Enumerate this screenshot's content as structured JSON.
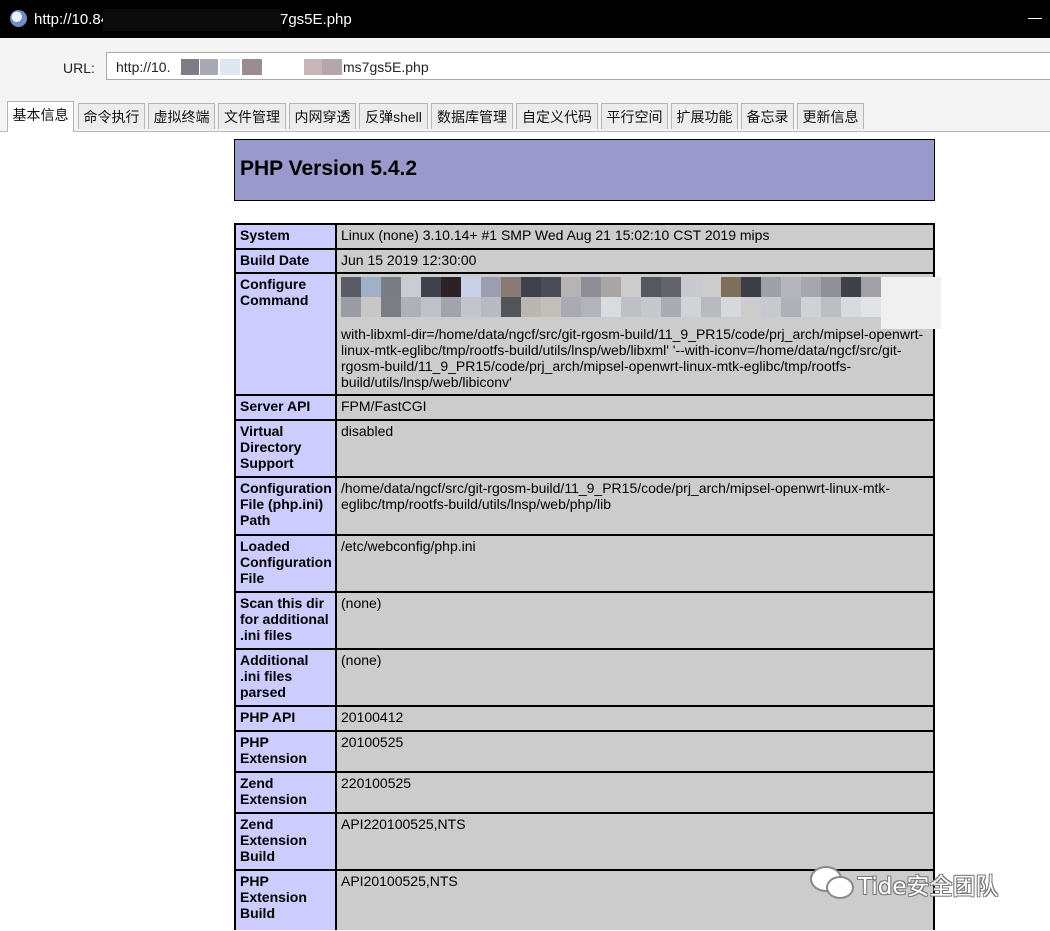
{
  "window": {
    "title_left": "http://10.84",
    "title_right": "7gs5E.php"
  },
  "address": {
    "label": "URL:",
    "value_left": "http://10.",
    "value_right": "ms7gs5E.php"
  },
  "tabs": [
    {
      "label": "基本信息",
      "active": true
    },
    {
      "label": "命令执行"
    },
    {
      "label": "虚拟终端"
    },
    {
      "label": "文件管理"
    },
    {
      "label": "内网穿透"
    },
    {
      "label": "反弹shell"
    },
    {
      "label": "数据库管理"
    },
    {
      "label": "自定义代码"
    },
    {
      "label": "平行空间"
    },
    {
      "label": "扩展功能"
    },
    {
      "label": "备忘录"
    },
    {
      "label": "更新信息"
    }
  ],
  "phpinfo": {
    "heading": "PHP Version 5.4.2",
    "rows": [
      {
        "key": "System",
        "value": "Linux (none) 3.10.14+ #1 SMP Wed Aug 21 15:02:10 CST 2019 mips"
      },
      {
        "key": "Build Date",
        "value": "Jun 15 2019 12:30:00"
      },
      {
        "key": "Configure Command",
        "value": "with-libxml-dir=/home/data/ngcf/src/git-rgosm-build/11_9_PR15/code/prj_arch/mipsel-openwrt-linux-mtk-eglibc/tmp/rootfs-build/utils/lnsp/web/libxml' '--with-iconv=/home/data/ngcf/src/git-rgosm-build/11_9_PR15/code/prj_arch/mipsel-openwrt-linux-mtk-eglibc/tmp/rootfs-build/utils/lnsp/web/libiconv'"
      },
      {
        "key": "Server API",
        "value": "FPM/FastCGI"
      },
      {
        "key": "Virtual Directory Support",
        "value": "disabled"
      },
      {
        "key": "Configuration File (php.ini) Path",
        "value": "/home/data/ngcf/src/git-rgosm-build/11_9_PR15/code/prj_arch/mipsel-openwrt-linux-mtk-eglibc/tmp/rootfs-build/utils/lnsp/web/php/lib"
      },
      {
        "key": "Loaded Configuration File",
        "value": "/etc/webconfig/php.ini"
      },
      {
        "key": "Scan this dir for additional .ini files",
        "value": "(none)"
      },
      {
        "key": "Additional .ini files parsed",
        "value": "(none)"
      },
      {
        "key": "PHP API",
        "value": "20100412"
      },
      {
        "key": "PHP Extension",
        "value": "20100525"
      },
      {
        "key": "Zend Extension",
        "value": "220100525"
      },
      {
        "key": "Zend Extension Build",
        "value": "API220100525,NTS"
      },
      {
        "key": "PHP Extension Build",
        "value": "API20100525,NTS"
      }
    ]
  },
  "watermark": {
    "text": "Tide安全团队",
    "icon": "wechat-icon"
  }
}
